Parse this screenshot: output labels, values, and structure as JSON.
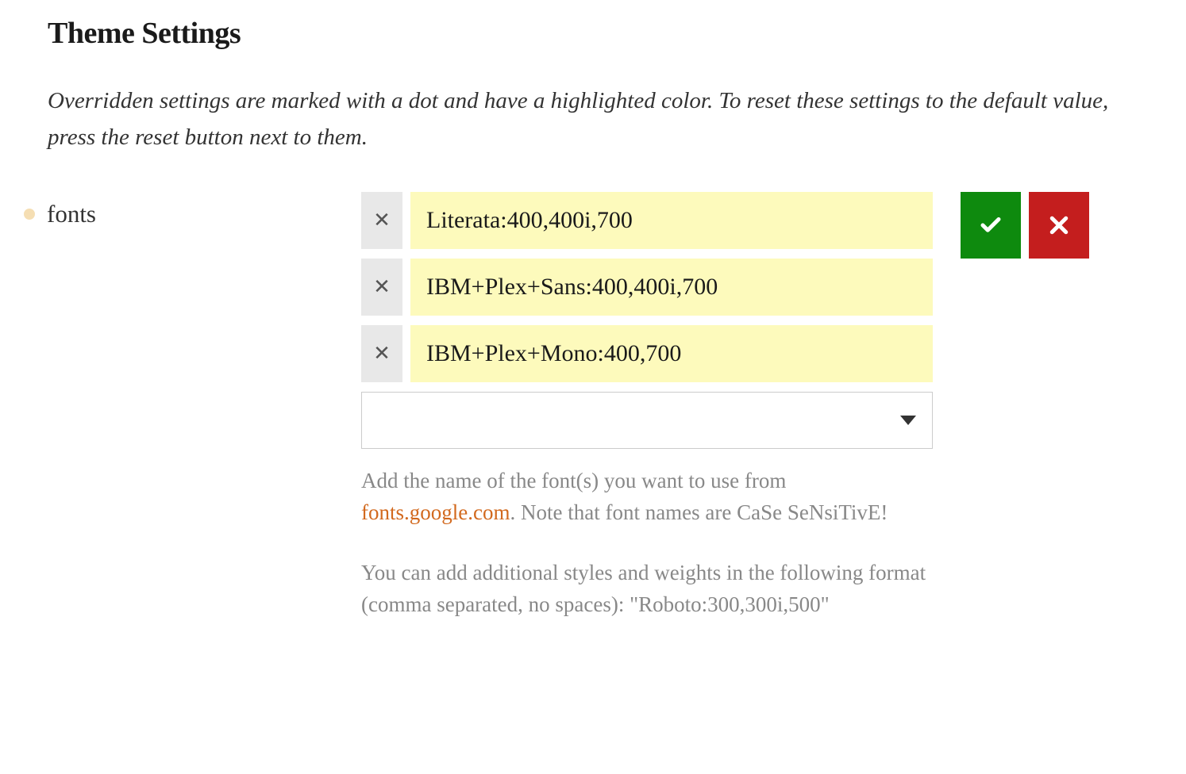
{
  "title": "Theme Settings",
  "description": "Overridden settings are marked with a dot and have a highlighted color. To reset these settings to the default value, press the reset button next to them.",
  "setting": {
    "label": "fonts",
    "overridden": true,
    "items": [
      "Literata:400,400i,700",
      "IBM+Plex+Sans:400,400i,700",
      "IBM+Plex+Mono:400,700"
    ],
    "dropdown_value": "",
    "help1_pre": "Add the name of the font(s) you want to use from ",
    "help1_link": "fonts.google.com",
    "help1_post": ". Note that font names are CaSe SeNsiTivE!",
    "help2": "You can add additional styles and weights in the following format (comma separated, no spaces): \"Roboto:300,300i,500\""
  }
}
